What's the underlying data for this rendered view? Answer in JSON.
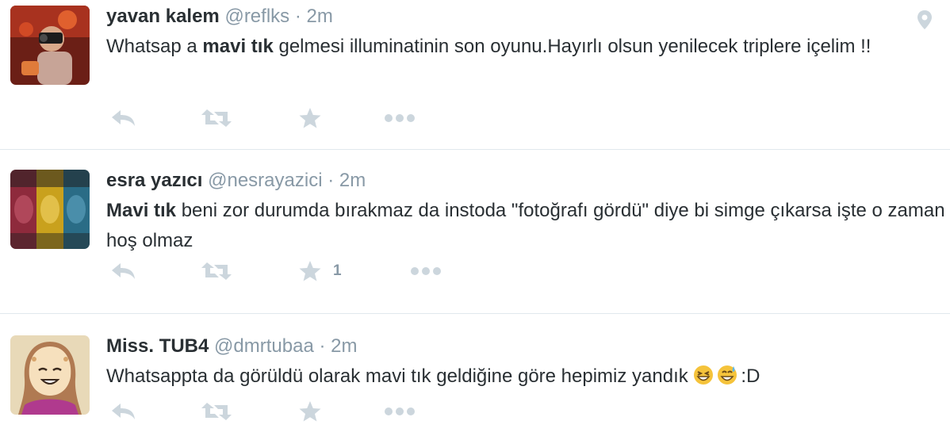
{
  "tweets": [
    {
      "fullname": "yavan kalem",
      "username": "@reflks",
      "separator": "·",
      "time": "2m",
      "text_bold": "mavi tık",
      "text_pre": "Whatsap a ",
      "text_post": " gelmesi illuminatinin son oyunu.Hayırlı olsun yenilecek triplere içelim !!",
      "favorite_count": "",
      "has_geo": true
    },
    {
      "fullname": "esra yazıcı",
      "username": "@nesrayazici",
      "separator": "·",
      "time": "2m",
      "text_bold": "Mavi tık",
      "text_pre": "",
      "text_post": " beni zor durumda bırakmaz da instoda \"fotoğrafı gördü\" diye bi simge çıkarsa işte o zaman hoş olmaz",
      "favorite_count": "1",
      "has_geo": false
    },
    {
      "fullname": "Miss. TUB4",
      "username": "@dmrtubaa",
      "separator": "·",
      "time": "2m",
      "text_pre": "Whatsappta da görüldü olarak mavi tık geldiğine göre hepimiz yandık ",
      "text_post": ":D",
      "emoji": [
        "grinning-squinting-face",
        "grinning-face-with-sweat"
      ],
      "favorite_count": "",
      "has_geo": false
    }
  ],
  "colors": {
    "icon_gray": "#ccd6dd",
    "meta_gray": "#8899a6",
    "text": "#292f33",
    "divider": "#e1e8ed"
  },
  "icons": [
    "reply-icon",
    "retweet-icon",
    "favorite-star-icon",
    "more-icon",
    "geo-pin-icon"
  ]
}
